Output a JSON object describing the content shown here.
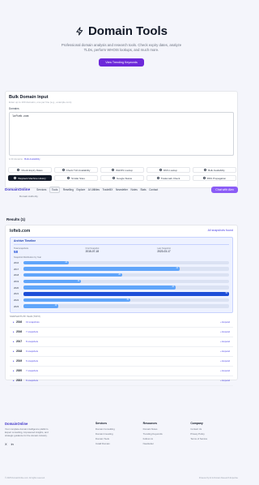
{
  "hero": {
    "title": "Domain Tools",
    "subtitle": "Professional domain analysis and research tools. Check expiry dates, analyze TLDs, perform WHOIS lookups, and much more.",
    "cta_label": "View Trending Keywords"
  },
  "bulk": {
    "title": "Bulk Domain Input",
    "hint": "Enter up to 100 domains, one per line (e.g., example.com)",
    "field_label": "Domains",
    "value": "lofteb.com",
    "footer_prefix": "1/10 domains",
    "footer_link": "Bulk Availability"
  },
  "tools": [
    {
      "label": "Check Expiry Dates",
      "active": false
    },
    {
      "label": "Check TLD Availability",
      "active": false
    },
    {
      "label": "WHOIS Lookup",
      "active": false
    },
    {
      "label": "DNS Lookup",
      "active": false
    },
    {
      "label": "Bulk Availability",
      "active": false
    },
    {
      "label": "Wayback Machine History",
      "active": true
    },
    {
      "label": "Similar Sites",
      "active": false
    },
    {
      "label": "Google Status",
      "active": false
    },
    {
      "label": "Trademark Check",
      "active": false
    },
    {
      "label": "DNS Propagation",
      "active": false
    }
  ],
  "nav": {
    "brand": "DomainOnline",
    "links": [
      "Services",
      "Tools",
      "Reselling",
      "Explore",
      "AI Utilities",
      "TradeMX",
      "Newsletter",
      "Notes",
      "Stats",
      "Contact"
    ],
    "chat_label": "Chat with Alex",
    "sub": "Domain Authority"
  },
  "results": {
    "section_title": "Results (1)",
    "domain": "lofteb.com",
    "found": "All snapshots found",
    "timeline_title": "Archive Timeline",
    "stats": [
      {
        "label": "Total snapshots",
        "value": "58"
      },
      {
        "label": "First Snapshot",
        "value": "2015-07-18"
      },
      {
        "label": "Last Snapshot",
        "value": "2023-03-17"
      }
    ],
    "dist_label": "Snapshot Distribution by Year",
    "distribution": [
      {
        "year": "2016",
        "count": 13,
        "pct": 0.22
      },
      {
        "year": "2017",
        "count": 44,
        "pct": 0.76
      },
      {
        "year": "2018",
        "count": 28,
        "pct": 0.48
      },
      {
        "year": "2019",
        "count": 16,
        "pct": 0.28
      },
      {
        "year": "2020",
        "count": 43,
        "pct": 0.74
      },
      {
        "year": "2021",
        "count": 58,
        "pct": 1.0
      },
      {
        "year": "2022",
        "count": 30,
        "pct": 0.52
      },
      {
        "year": "2023",
        "count": 10,
        "pct": 0.17
      }
    ],
    "snap_label": "SNAPSHOTS BY YEAR (TOP 8)",
    "years": [
      {
        "year": "2016",
        "count": "13 snapshots",
        "expand": "Expand"
      },
      {
        "year": "2016",
        "count": "7 snapshots",
        "expand": "Expand"
      },
      {
        "year": "2017",
        "count": "8 snapshots",
        "expand": "Expand"
      },
      {
        "year": "2018",
        "count": "9 snapshots",
        "expand": "Expand"
      },
      {
        "year": "2019",
        "count": "6 snapshots",
        "expand": "Expand"
      },
      {
        "year": "2020",
        "count": "7 snapshots",
        "expand": "Expand"
      },
      {
        "year": "2023",
        "count": "8 snapshots",
        "expand": "Expand"
      }
    ]
  },
  "footer": {
    "brand": "DomainOnline",
    "desc": "Your complete domain intelligence platform. Expert consulting, AI-powered insights, and strategic guidance for the domain industry.",
    "social": [
      "X",
      "in"
    ],
    "cols": [
      {
        "head": "Services",
        "links": [
          "Domain Consulting",
          "Domain Investing",
          "Domain Tools",
          "Install Domain"
        ]
      },
      {
        "head": "Resources",
        "links": [
          "Domain Notes",
          "Trending Keywords",
          "Follow Us",
          "Newsletter"
        ]
      },
      {
        "head": "Company",
        "links": [
          "Contact Us",
          "Privacy Policy",
          "Terms of Service"
        ]
      }
    ],
    "copyright": "© 2025 DomainOnline.com. All rights reserved.",
    "powered": "Powered by AI & Domain Research Expertise"
  }
}
